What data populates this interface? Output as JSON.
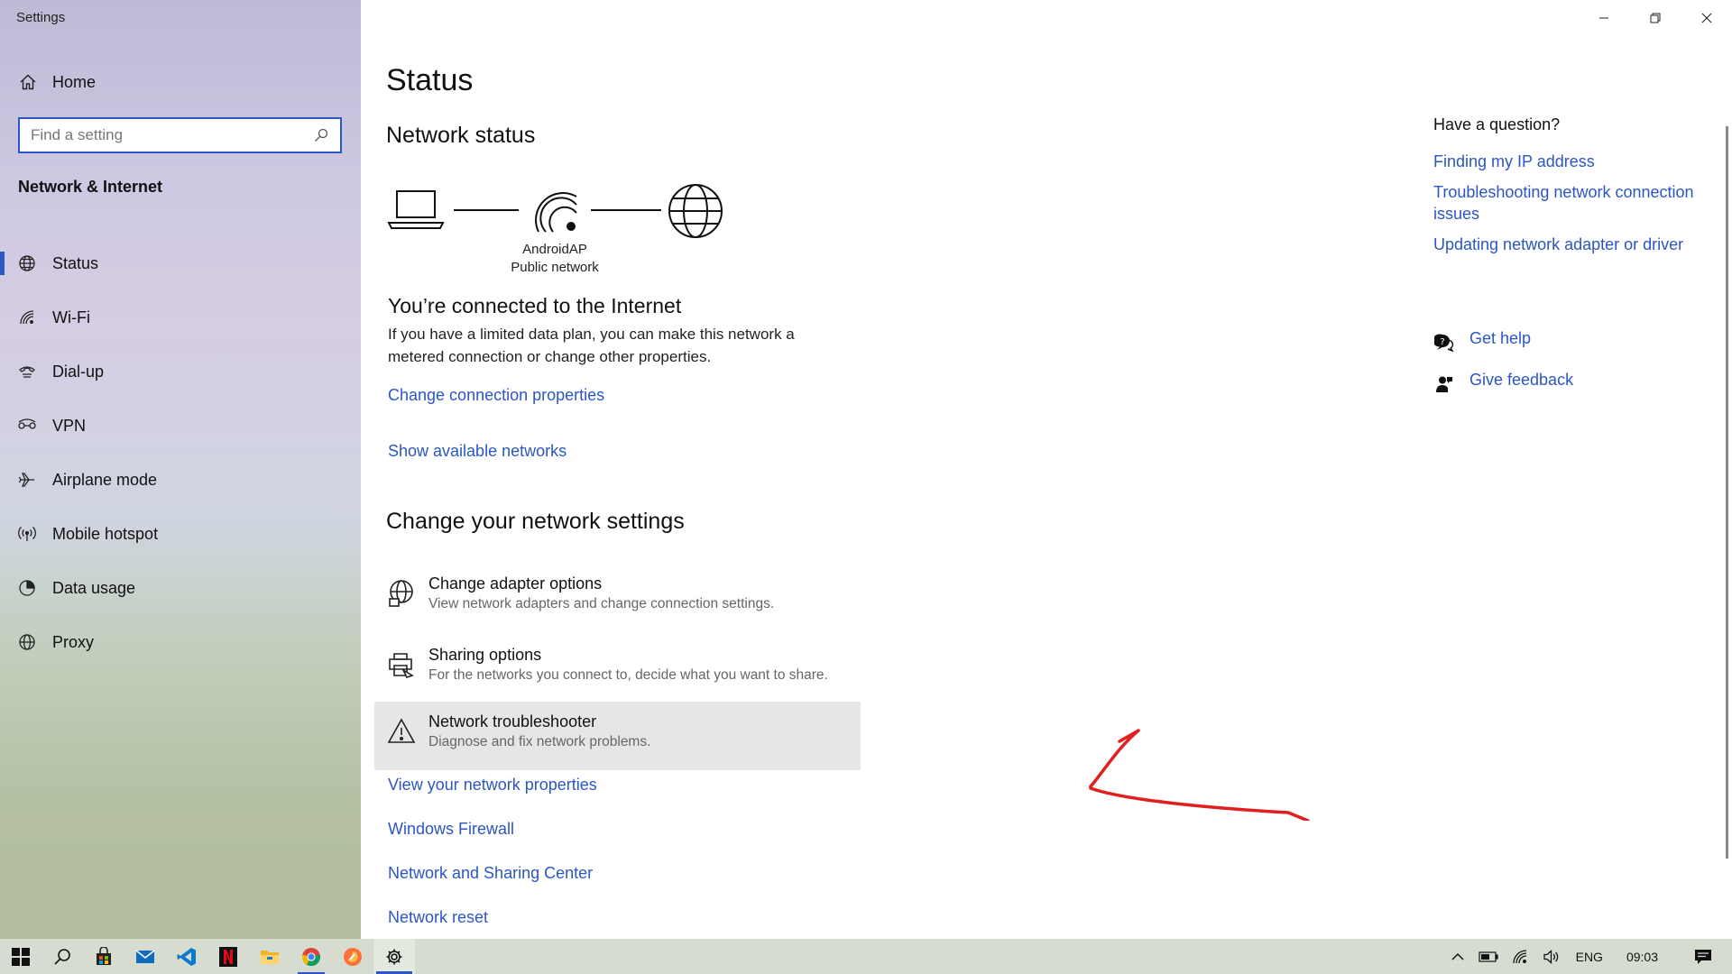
{
  "window": {
    "title": "Settings"
  },
  "sidebar": {
    "home_label": "Home",
    "search_placeholder": "Find a setting",
    "section_title": "Network & Internet",
    "items": [
      {
        "label": "Status",
        "icon": "globe-icon",
        "selected": true
      },
      {
        "label": "Wi-Fi",
        "icon": "wifi-icon",
        "selected": false
      },
      {
        "label": "Dial-up",
        "icon": "dialup-icon",
        "selected": false
      },
      {
        "label": "VPN",
        "icon": "vpn-icon",
        "selected": false
      },
      {
        "label": "Airplane mode",
        "icon": "airplane-icon",
        "selected": false
      },
      {
        "label": "Mobile hotspot",
        "icon": "hotspot-icon",
        "selected": false
      },
      {
        "label": "Data usage",
        "icon": "data-usage-icon",
        "selected": false
      },
      {
        "label": "Proxy",
        "icon": "globe-icon",
        "selected": false
      }
    ]
  },
  "main": {
    "title": "Status",
    "network_status_title": "Network status",
    "network_name": "AndroidAP",
    "network_type": "Public network",
    "connected_title": "You’re connected to the Internet",
    "connected_desc": "If you have a limited data plan, you can make this network a metered connection or change other properties.",
    "change_connection_link": "Change connection properties",
    "show_networks_link": "Show available networks",
    "change_settings_title": "Change your network settings",
    "options": [
      {
        "title": "Change adapter options",
        "desc": "View network adapters and change connection settings.",
        "icon": "adapter-icon"
      },
      {
        "title": "Sharing options",
        "desc": "For the networks you connect to, decide what you want to share.",
        "icon": "sharing-icon"
      },
      {
        "title": "Network troubleshooter",
        "desc": "Diagnose and fix network problems.",
        "icon": "warning-icon"
      }
    ],
    "links": [
      "View your network properties",
      "Windows Firewall",
      "Network and Sharing Center",
      "Network reset"
    ]
  },
  "right": {
    "question_title": "Have a question?",
    "links": [
      "Finding my IP address",
      "Troubleshooting network connection issues",
      "Updating network adapter or driver"
    ],
    "get_help": "Get help",
    "give_feedback": "Give feedback"
  },
  "taskbar": {
    "language": "ENG",
    "time": "09:03",
    "apps": [
      "start-icon",
      "search-icon",
      "store-icon",
      "mail-icon",
      "vscode-icon",
      "netflix-icon",
      "file-explorer-icon",
      "chrome-icon",
      "firefox-icon",
      "settings-icon"
    ]
  },
  "colors": {
    "accent": "#2b56c4",
    "annotation": "#e0201e",
    "hover_row": "#e6e6e6"
  }
}
